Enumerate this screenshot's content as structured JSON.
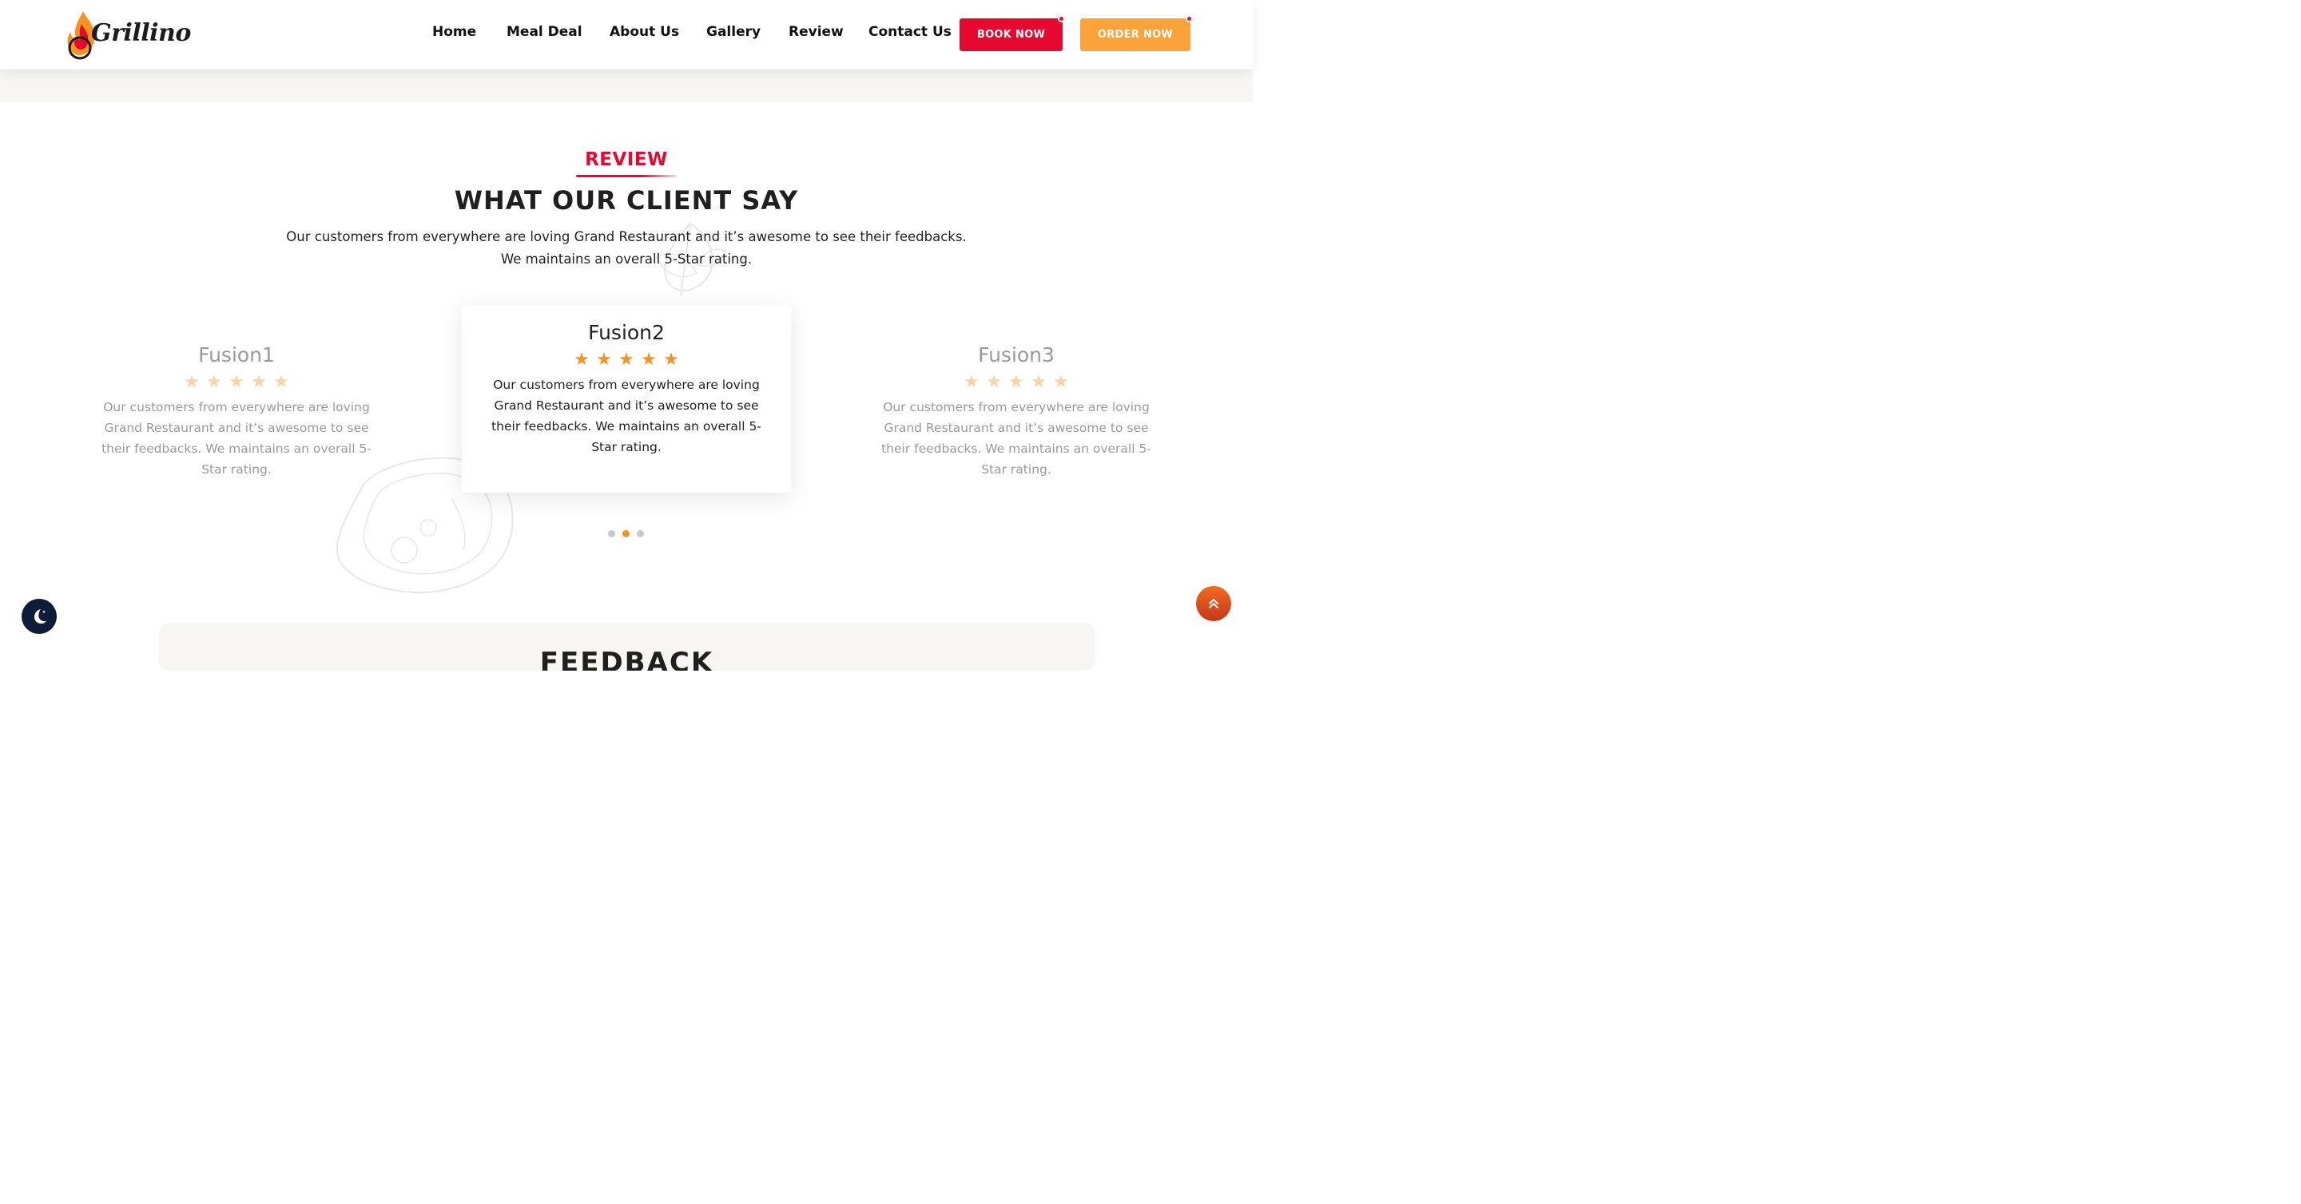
{
  "brand": {
    "name": "Grillino"
  },
  "nav": {
    "items": [
      {
        "label": "Home"
      },
      {
        "label": "Meal Deal"
      },
      {
        "label": "About Us"
      },
      {
        "label": "Gallery"
      },
      {
        "label": "Review"
      },
      {
        "label": "Contact Us"
      }
    ],
    "book_label": "BOOK NOW",
    "order_label": "ORDER NOW"
  },
  "review": {
    "eyebrow": "REVIEW",
    "heading": "WHAT OUR CLIENT SAY",
    "intro_line1": "Our customers from everywhere are loving Grand Restaurant and it’s awesome to see their feedbacks.",
    "intro_line2": "We maintains an overall 5-Star rating.",
    "cards": [
      {
        "name": "Fusion1",
        "rating": 5,
        "text": "Our customers from everywhere are loving Grand Restaurant and it’s awesome to see their feedbacks. We maintains an overall 5-Star rating."
      },
      {
        "name": "Fusion2",
        "rating": 5,
        "text": "Our customers from everywhere are loving Grand Restaurant and it’s awesome to see their feedbacks. We maintains an overall 5-Star rating."
      },
      {
        "name": "Fusion3",
        "rating": 5,
        "text": "Our customers from everywhere are loving Grand Restaurant and it’s awesome to see their feedbacks. We maintains an overall 5-Star rating."
      }
    ],
    "carousel": {
      "pages": 3,
      "active_page": 2
    }
  },
  "feedback": {
    "title": "FEEDBACK"
  },
  "icons": {
    "theme_toggle": "moon-icon",
    "scroll_top": "double-chevron-up-icon"
  },
  "colors": {
    "accent_red": "#e5092f",
    "accent_orange": "#f9a33a",
    "star": "#f7931e",
    "dark_navy": "#0e1c3a"
  }
}
